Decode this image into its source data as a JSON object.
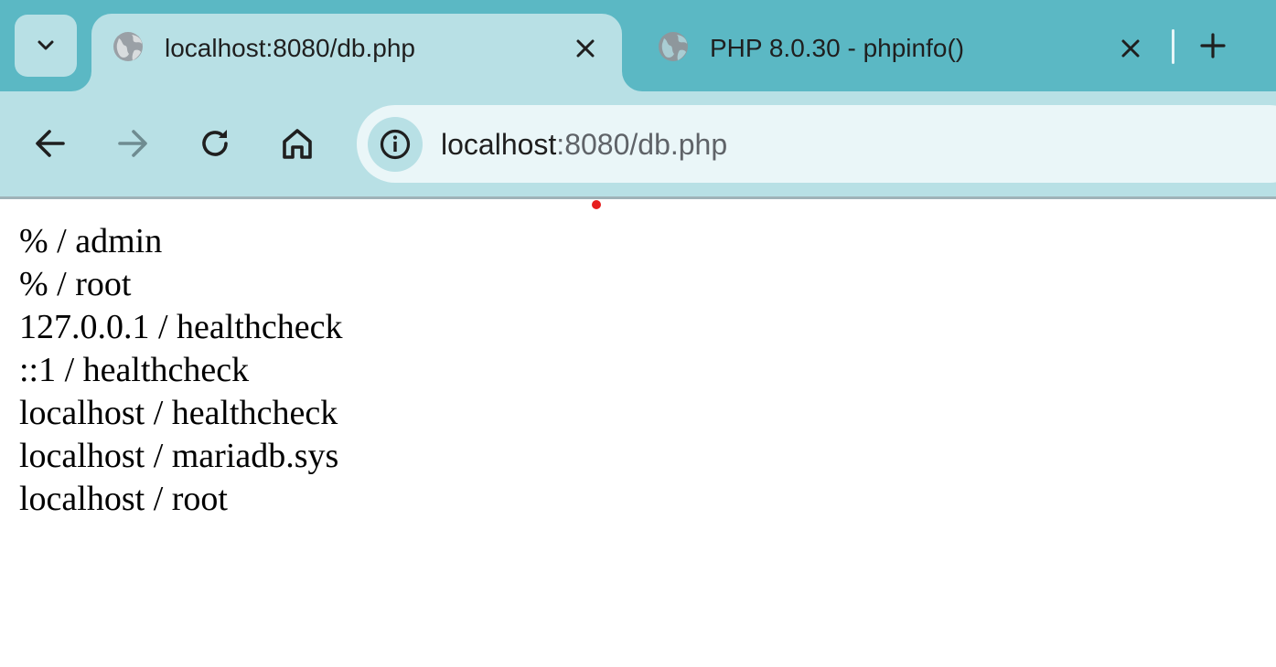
{
  "tabs": [
    {
      "title": "localhost:8080/db.php",
      "active": true,
      "favicon": "globe-icon"
    },
    {
      "title": "PHP 8.0.30 - phpinfo()",
      "active": false,
      "favicon": "globe-icon"
    }
  ],
  "address_bar": {
    "host": "localhost",
    "rest": ":8080/db.php"
  },
  "page": {
    "rows": [
      "% / admin",
      "% / root",
      "127.0.0.1 / healthcheck",
      "::1 / healthcheck",
      "localhost / healthcheck",
      "localhost / mariadb.sys",
      "localhost / root"
    ]
  },
  "colors": {
    "tabstrip": "#5bb8c4",
    "active_tab": "#b8e0e5",
    "omnibox": "#eaf6f8",
    "cursor_dot": "#e61e1e"
  }
}
